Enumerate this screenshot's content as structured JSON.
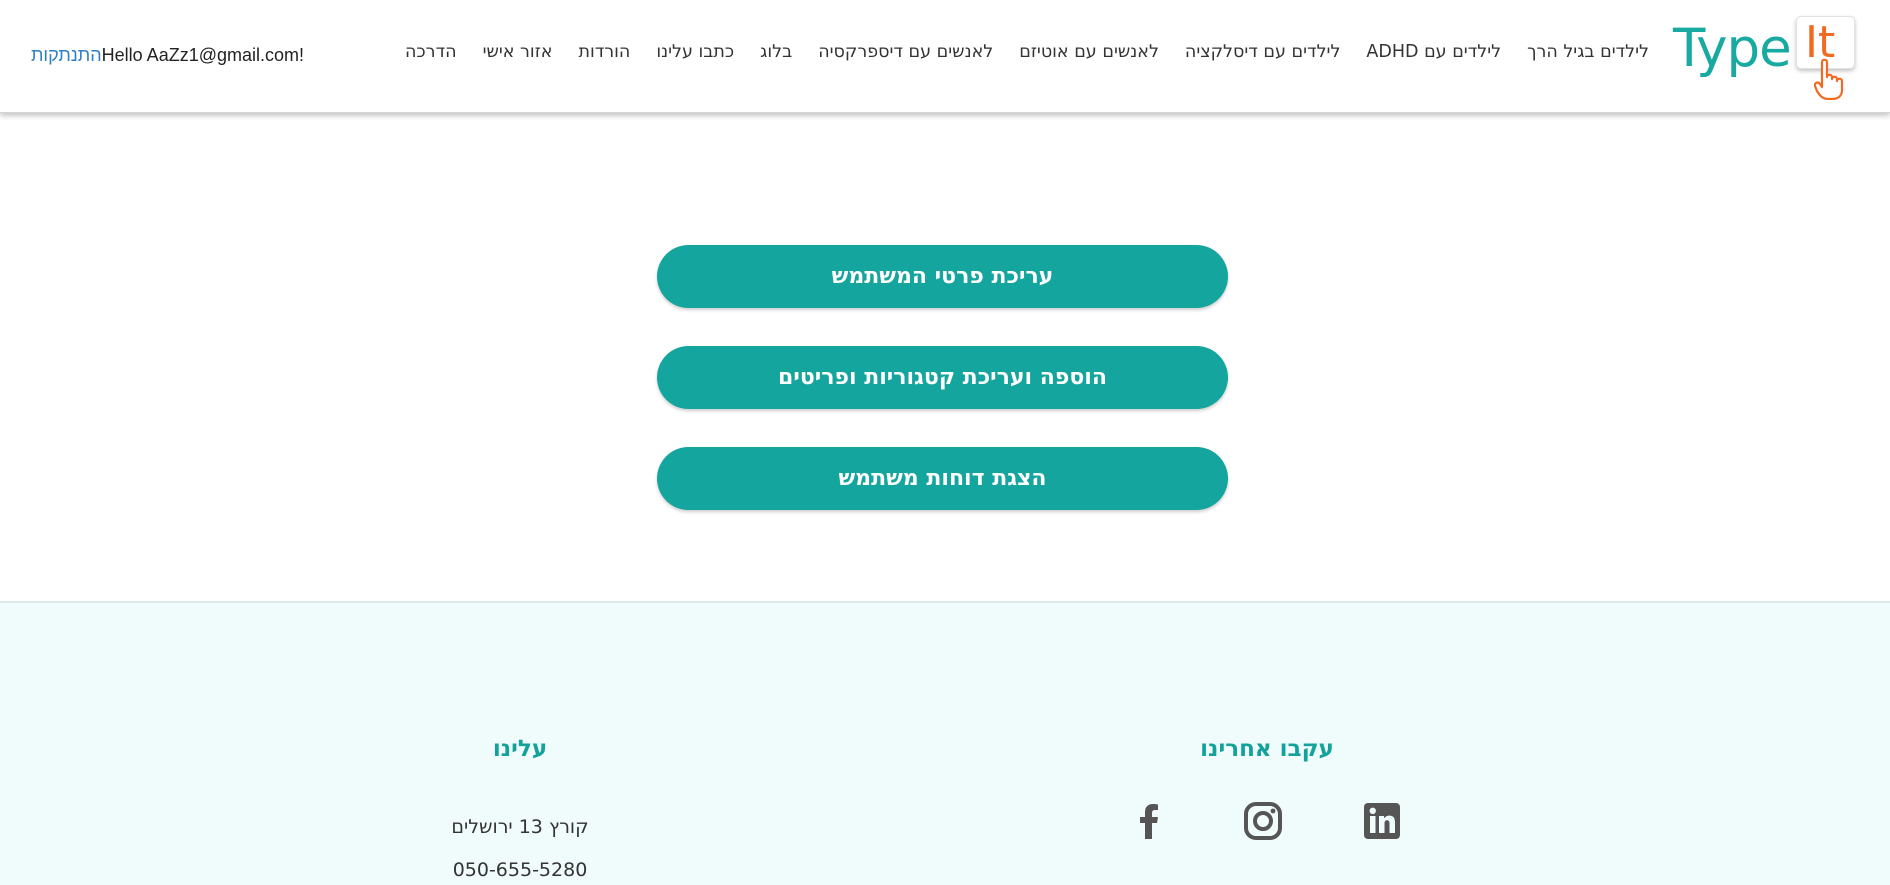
{
  "header": {
    "logo": {
      "type_text": "Type",
      "it_text": "It"
    },
    "nav": [
      "לילדים בגיל הרך",
      "לילדים עם ADHD",
      "לילדים עם דיסלקציה",
      "לאנשים עם אוטיזם",
      "לאנשים עם דיספרקסיה",
      "בלוג",
      "כתבו עלינו",
      "הורדות",
      "אזור אישי",
      "הדרכה"
    ],
    "user": {
      "logout_label": "התנתקות",
      "greeting": "Hello AaZz1@gmail.com!"
    }
  },
  "main": {
    "buttons": [
      "עריכת פרטי המשתמש",
      "הוספה ועריכת קטגוריות ופריטים",
      "הצגת דוחות משתמש"
    ]
  },
  "footer": {
    "follow_title": "עקבו אחרינו",
    "socials": [
      "facebook-icon",
      "instagram-icon",
      "linkedin-icon"
    ],
    "about_title": "עלינו",
    "address": "קורץ 13 ירושלים",
    "phone": "050-655-5280"
  },
  "colors": {
    "brand_teal": "#14a59e",
    "brand_orange": "#f26a21",
    "link_blue": "#2f7fc4",
    "footer_bg": "#f0fbfb"
  }
}
